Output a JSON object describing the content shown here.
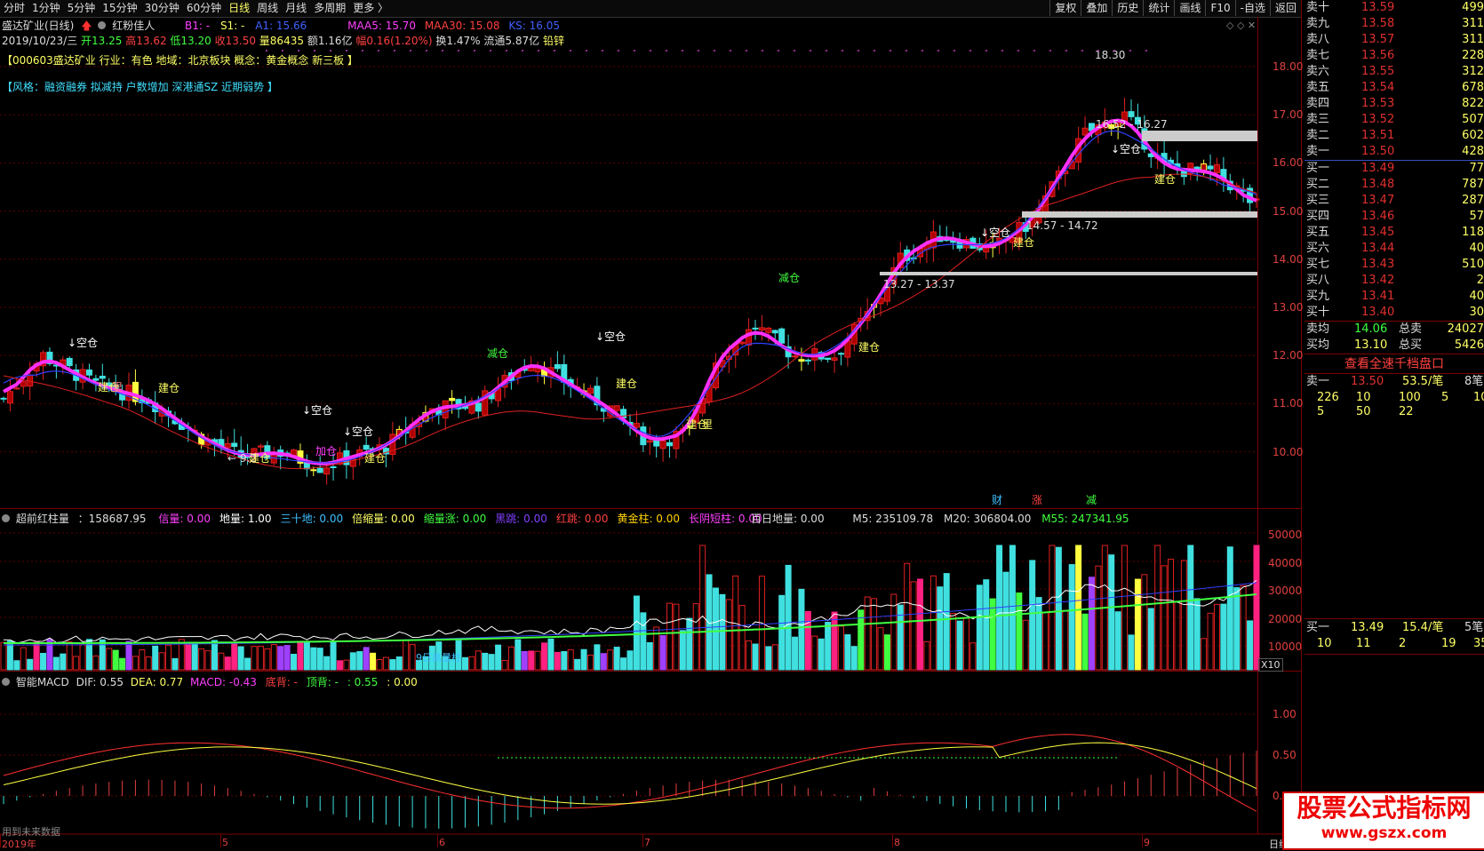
{
  "topbar": {
    "tabs": [
      "分时",
      "1分钟",
      "5分钟",
      "15分钟",
      "30分钟",
      "60分钟",
      "日线",
      "周线",
      "月线",
      "多周期",
      "更多 〉"
    ],
    "active_tab": "日线",
    "right_buttons": [
      "复权",
      "叠加",
      "历史",
      "统计",
      "画线",
      "F10",
      "-自选",
      "返回"
    ]
  },
  "stock": {
    "name_period": "盛达矿业(日线)",
    "indicator_name": "红粉佳人",
    "b1": "B1: -",
    "s1": "S1: -",
    "a1": "A1: 15.66",
    "maa5": "MAA5: 15.70",
    "maa30": "MAA30: 15.08",
    "ks": "KS: 16.05",
    "date": "2019/10/23/三",
    "open": "开13.25",
    "high": "高13.62",
    "low": "低13.20",
    "close": "收13.50",
    "volume": "量86435",
    "amount": "额1.16亿",
    "change": "幅0.16(1.20%)",
    "turnover": "换1.47%",
    "float": "流通5.87亿",
    "sector": "铅锌",
    "info1": "【000603盛达矿业 行业：有色 地域：北京板块 概念：黄金概念 新三板 】",
    "info2": "【风格：融资融券 拟减持 户数增加 深港通SZ 近期弱势 】"
  },
  "price_axis": [
    "18.00",
    "17.00",
    "16.00",
    "15.00",
    "14.00",
    "13.00",
    "12.00",
    "11.00",
    "10.00"
  ],
  "price_annotations": {
    "high": "18.30",
    "low": "9.2",
    "zone1": "16.52 - 16.27",
    "zone2": "14.57 - 14.72",
    "zone3": "13.27 - 13.37",
    "signals": [
      "空仓",
      "建仓",
      "加仓",
      "减仓",
      "里"
    ],
    "markers": [
      "财",
      "涨",
      "减"
    ]
  },
  "vol_panel": {
    "title": "超前红柱量",
    "value": "：158687.95",
    "items": [
      {
        "t": "信量: 0.00",
        "c": "#ff40ff"
      },
      {
        "t": "地量: 1.00",
        "c": "#ffffff"
      },
      {
        "t": "三十地: 0.00",
        "c": "#40c0ff"
      },
      {
        "t": "倍缩量: 0.00",
        "c": "#ffff66"
      },
      {
        "t": "缩量涨: 0.00",
        "c": "#40ff40"
      },
      {
        "t": "黑跳: 0.00",
        "c": "#8040ff"
      },
      {
        "t": "红跳: 0.00",
        "c": "#ff4040"
      },
      {
        "t": "黄金柱: 0.00",
        "c": "#ffd000"
      },
      {
        "t": "长阴短柱: 0.00",
        "c": "#ff40ff"
      }
    ],
    "bairi": "百日地量: 0.00",
    "m5": "M5: 235109.78",
    "m20": "M20: 306804.00",
    "m55": "M55: 247341.95",
    "axis": [
      "50000",
      "40000",
      "30000",
      "20000",
      "10000"
    ],
    "x10": "X10",
    "label": "9日高量柱"
  },
  "macd_panel": {
    "title": "智能MACD",
    "dif": "DIF: 0.55",
    "dea": "DEA: 0.77",
    "macd": "MACD: -0.43",
    "dibei": "底背: -",
    "dingbei": "顶背: -",
    "v1": ": 0.55",
    "v2": ": 0.00",
    "axis": [
      "1.00",
      "0.50",
      "0.00"
    ],
    "footer": "用到未来数据"
  },
  "time_axis": [
    "2019年",
    "5",
    "6",
    "7",
    "8",
    "9"
  ],
  "time_axis_right": "日线",
  "orderbook": {
    "asks": [
      {
        "k": "卖十",
        "p": "13.59",
        "v": "499"
      },
      {
        "k": "卖九",
        "p": "13.58",
        "v": "311"
      },
      {
        "k": "卖八",
        "p": "13.57",
        "v": "311"
      },
      {
        "k": "卖七",
        "p": "13.56",
        "v": "228"
      },
      {
        "k": "卖六",
        "p": "13.55",
        "v": "312"
      },
      {
        "k": "卖五",
        "p": "13.54",
        "v": "678"
      },
      {
        "k": "卖四",
        "p": "13.53",
        "v": "822"
      },
      {
        "k": "卖三",
        "p": "13.52",
        "v": "507"
      },
      {
        "k": "卖二",
        "p": "13.51",
        "v": "602"
      },
      {
        "k": "卖一",
        "p": "13.50",
        "v": "428"
      }
    ],
    "bids": [
      {
        "k": "买一",
        "p": "13.49",
        "v": "77"
      },
      {
        "k": "买二",
        "p": "13.48",
        "v": "787"
      },
      {
        "k": "买三",
        "p": "13.47",
        "v": "287"
      },
      {
        "k": "买四",
        "p": "13.46",
        "v": "57"
      },
      {
        "k": "买五",
        "p": "13.45",
        "v": "118"
      },
      {
        "k": "买六",
        "p": "13.44",
        "v": "40"
      },
      {
        "k": "买七",
        "p": "13.43",
        "v": "510"
      },
      {
        "k": "买八",
        "p": "13.42",
        "v": "2"
      },
      {
        "k": "买九",
        "p": "13.41",
        "v": "40"
      },
      {
        "k": "买十",
        "p": "13.40",
        "v": "30"
      }
    ],
    "sell_avg_label": "卖均",
    "sell_avg": "14.06",
    "total_sell_label": "总卖",
    "total_sell": "24027",
    "buy_avg_label": "买均",
    "buy_avg": "13.10",
    "total_buy_label": "总买",
    "total_buy": "5426",
    "view_link": "查看全速千档盘口",
    "ask1_label": "卖一",
    "ask1_price": "13.50",
    "ask1_per": "53.5/笔",
    "ask1_count": "8笔",
    "ask1_q1": [
      "226",
      "10",
      "100",
      "5",
      "10"
    ],
    "ask1_q2": [
      "5",
      "50",
      "22"
    ],
    "bid1_label": "买一",
    "bid1_price": "13.49",
    "bid1_per": "15.4/笔",
    "bid1_count": "5笔",
    "bid1_q": [
      "10",
      "11",
      "2",
      "19",
      "35"
    ]
  },
  "watermark": {
    "line1": "股票公式指标网",
    "line2": "www.gszx.com"
  }
}
